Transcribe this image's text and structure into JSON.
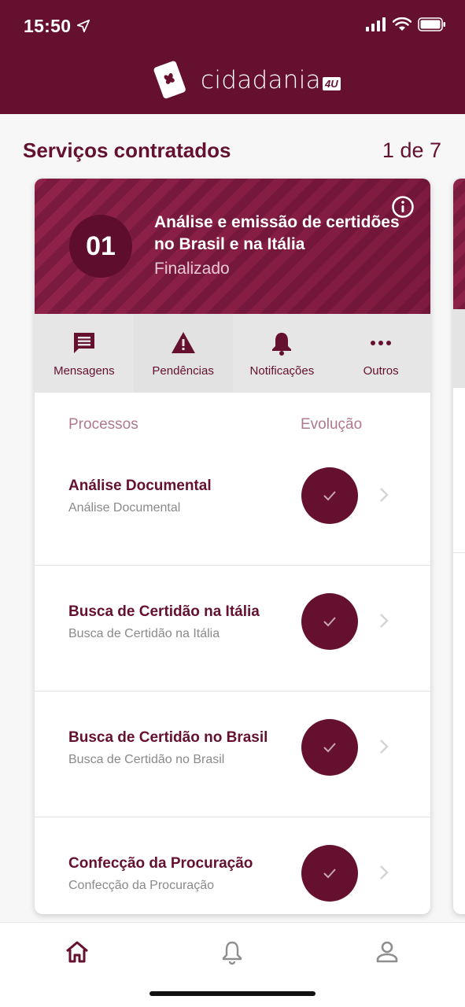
{
  "status_bar": {
    "time": "15:50"
  },
  "app": {
    "logo_text": "cidadania",
    "logo_badge": "4U"
  },
  "section": {
    "title": "Serviços contratados",
    "pager": "1 de 7"
  },
  "service": {
    "number": "01",
    "title": "Análise e emissão de certidões no Brasil e na Itália",
    "status": "Finalizado"
  },
  "actions": [
    {
      "label": "Mensagens",
      "icon": "message-icon"
    },
    {
      "label": "Pendências",
      "icon": "warning-icon"
    },
    {
      "label": "Notificações",
      "icon": "bell-icon"
    },
    {
      "label": "Outros",
      "icon": "more-icon"
    }
  ],
  "list_header": {
    "processes": "Processos",
    "evolution": "Evolução"
  },
  "processes": [
    {
      "title": "Análise Documental",
      "subtitle": "Análise Documental"
    },
    {
      "title": "Busca de Certidão na Itália",
      "subtitle": "Busca de Certidão na Itália"
    },
    {
      "title": "Busca de Certidão no Brasil",
      "subtitle": "Busca de Certidão no Brasil"
    },
    {
      "title": "Confecção da Procuração",
      "subtitle": "Confecção da Procuração"
    }
  ],
  "tabbar": [
    "home-icon",
    "bell-icon",
    "profile-icon"
  ],
  "colors": {
    "brand": "#661030",
    "header_stripe_light": "#8f2249",
    "muted_label": "#b07890"
  }
}
